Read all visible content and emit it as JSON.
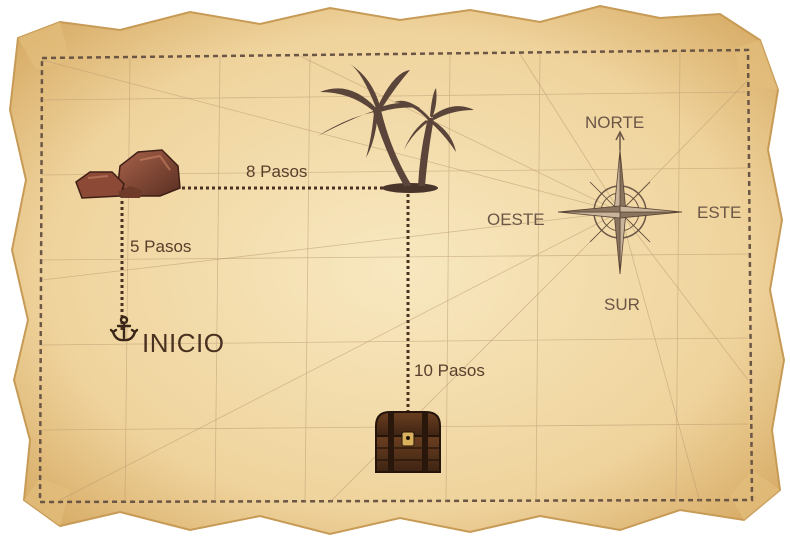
{
  "map": {
    "start_label": "INICIO",
    "steps": {
      "north": "5 Pasos",
      "east": "8 Pasos",
      "south": "10 Pasos"
    },
    "compass": {
      "north": "NORTE",
      "south": "SUR",
      "east": "ESTE",
      "west": "OESTE"
    },
    "icons": {
      "start": "anchor-icon",
      "waypoint_1": "rocks-icon",
      "waypoint_2": "palm-trees-icon",
      "goal": "treasure-chest-icon",
      "compass": "compass-rose-icon"
    },
    "colors": {
      "parchment": "#f1d9a6",
      "parchment_edge": "#d9b16e",
      "ink": "#5a3e2b",
      "path": "#4a3222",
      "border_dash": "#6b5646"
    }
  }
}
